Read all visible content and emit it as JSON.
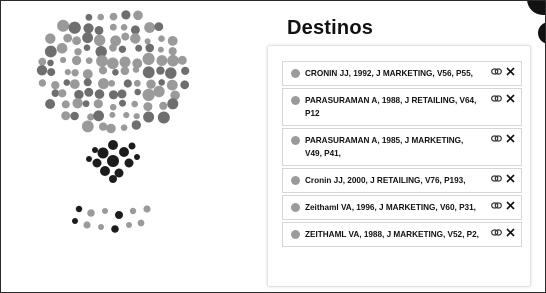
{
  "panel": {
    "title": "Destinos"
  },
  "references": [
    {
      "text": "CRONIN JJ, 1992, J MARKETING, V56, P55,"
    },
    {
      "text": "PARASURAMAN A, 1988, J RETAILING, V64, P12"
    },
    {
      "text": "PARASURAMAN A, 1985, J MARKETING, V49, P41,"
    },
    {
      "text": "Cronin JJ, 2000, J RETAILING, V76, P193,"
    },
    {
      "text": "Zeithaml VA, 1996, J MARKETING, V60, P31,"
    },
    {
      "text": "ZEITHAML VA, 1988, J MARKETING, V52, P2,"
    }
  ],
  "icons": {
    "link": "link-icon",
    "remove": "close-icon"
  },
  "colors": {
    "node_light": "#9a9a9a",
    "node_mid": "#6e6e6e",
    "node_dark": "#1c1c1c"
  }
}
